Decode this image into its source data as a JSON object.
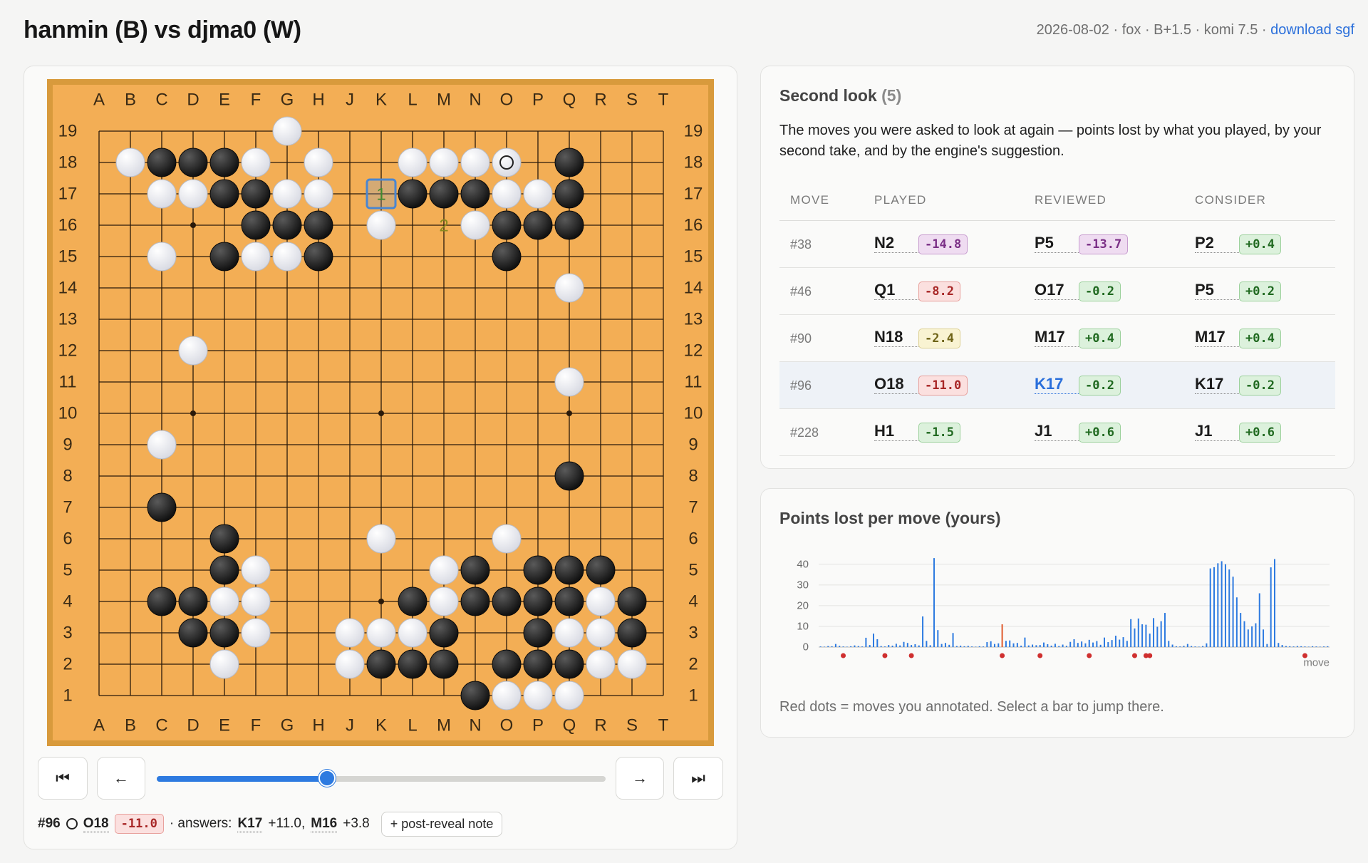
{
  "page": {
    "title": "hanmin (B) vs djma0 (W)",
    "meta": "2026-08-02 · fox · B+1.5 · komi 7.5 ·",
    "download": "download sgf"
  },
  "board": {
    "size": 19,
    "col_labels": [
      "A",
      "B",
      "C",
      "D",
      "E",
      "F",
      "G",
      "H",
      "J",
      "K",
      "L",
      "M",
      "N",
      "O",
      "P",
      "Q",
      "R",
      "S",
      "T"
    ],
    "row_labels": [
      "19",
      "18",
      "17",
      "16",
      "15",
      "14",
      "13",
      "12",
      "11",
      "10",
      "9",
      "8",
      "7",
      "6",
      "5",
      "4",
      "3",
      "2",
      "1"
    ],
    "colors": {
      "wood": "#f3ae55",
      "frame": "#d89a3c"
    },
    "black": [
      "C18",
      "D18",
      "E18",
      "E17",
      "F17",
      "F16",
      "G16",
      "H16",
      "E15",
      "H15",
      "L17",
      "M17",
      "N17",
      "O16",
      "P16",
      "Q16",
      "Q17",
      "Q18",
      "O15",
      "Q8",
      "C7",
      "E6",
      "E5",
      "N5",
      "P5",
      "Q5",
      "R5",
      "C4",
      "D4",
      "L4",
      "N4",
      "O4",
      "P4",
      "Q4",
      "S4",
      "D3",
      "E3",
      "M3",
      "P3",
      "S3",
      "K2",
      "L2",
      "M2",
      "O2",
      "P2",
      "Q2",
      "N1"
    ],
    "white": [
      "G19",
      "B18",
      "F18",
      "H18",
      "L18",
      "M18",
      "N18",
      "O18",
      "C17",
      "D17",
      "G17",
      "H17",
      "O17",
      "P17",
      "K16",
      "N16",
      "C15",
      "F15",
      "G15",
      "Q14",
      "D12",
      "Q11",
      "C9",
      "K6",
      "O6",
      "F5",
      "M5",
      "E4",
      "F4",
      "M4",
      "R4",
      "F3",
      "J3",
      "K3",
      "L3",
      "Q3",
      "R3",
      "E2",
      "J2",
      "R2",
      "S2",
      "O1",
      "P1",
      "Q1"
    ],
    "hoshi": [
      "D16",
      "K16",
      "Q16",
      "D10",
      "K10",
      "Q10",
      "D4",
      "K4",
      "Q4"
    ],
    "last_move": "O18",
    "highlight": "K17",
    "markers": [
      {
        "point": "K17",
        "label": "1",
        "color": "#3f8a2e"
      },
      {
        "point": "M16",
        "label": "2",
        "color": "#8a8a1e"
      }
    ]
  },
  "controls": {
    "first_icon": "⏮",
    "prev_icon": "←",
    "next_icon": "→",
    "last_icon": "⏭",
    "slider_value": 0.38
  },
  "move_bar": {
    "number": "#96",
    "coord": "O18",
    "loss": "-11.0",
    "answers_label": "· answers:",
    "ans1_coord": "K17",
    "ans1_val": "+11.0,",
    "ans2_coord": "M16",
    "ans2_val": "+3.8",
    "note_button": "+ post-reveal note"
  },
  "review": {
    "title": "Second look",
    "count": "(5)",
    "description": "The moves you were asked to look at again — points lost by what you played, by your second take, and by the engine's suggestion.",
    "headers": [
      "MOVE",
      "PLAYED",
      "REVIEWED",
      "CONSIDER"
    ],
    "rows": [
      {
        "move": "#38",
        "played": "N2",
        "played_loss": "-14.8",
        "reviewed": "P5",
        "reviewed_loss": "-13.7",
        "consider": "P2",
        "consider_loss": "+0.4"
      },
      {
        "move": "#46",
        "played": "Q1",
        "played_loss": "-8.2",
        "reviewed": "O17",
        "reviewed_loss": "-0.2",
        "consider": "P5",
        "consider_loss": "+0.2"
      },
      {
        "move": "#90",
        "played": "N18",
        "played_loss": "-2.4",
        "reviewed": "M17",
        "reviewed_loss": "+0.4",
        "consider": "M17",
        "consider_loss": "+0.4"
      },
      {
        "move": "#96",
        "played": "O18",
        "played_loss": "-11.0",
        "reviewed": "K17",
        "reviewed_loss": "-0.2",
        "consider": "K17",
        "consider_loss": "-0.2"
      },
      {
        "move": "#228",
        "played": "H1",
        "played_loss": "-1.5",
        "reviewed": "J1",
        "reviewed_loss": "+0.6",
        "consider": "J1",
        "consider_loss": "+0.6"
      }
    ]
  },
  "chart": {
    "title": "Points lost per move (yours)",
    "footnote": "Red dots = moves you annotated. Select a bar to jump there."
  },
  "chart_data": {
    "type": "bar",
    "title": "Points lost per move (yours)",
    "xlabel": "move",
    "ylabel": "",
    "ylim": [
      0,
      42
    ],
    "yticks": [
      0,
      10,
      20,
      30,
      40
    ],
    "n_moves": 135,
    "bar_color": "#2d7ae0",
    "highlight_color": "#e05a2d",
    "highlight_index": 48,
    "values": [
      0.3,
      0.2,
      0.5,
      0.4,
      1.5,
      0.6,
      0.3,
      0.2,
      0.4,
      0.8,
      0.5,
      0.3,
      4.5,
      1.0,
      6.5,
      3.8,
      0.5,
      0.3,
      1.0,
      0.7,
      1.6,
      0.8,
      2.5,
      2.0,
      1.0,
      1.4,
      0.8,
      14.8,
      3.0,
      0.9,
      43.0,
      8.2,
      1.5,
      2.0,
      1.1,
      6.8,
      0.5,
      0.7,
      0.4,
      0.6,
      0.3,
      0.2,
      0.4,
      0.3,
      2.4,
      2.8,
      1.5,
      1.8,
      11.0,
      3.0,
      3.2,
      1.8,
      2.0,
      0.7,
      4.6,
      0.8,
      1.2,
      0.9,
      1.0,
      2.2,
      1.4,
      0.7,
      1.6,
      0.5,
      1.2,
      0.6,
      2.5,
      3.8,
      2.0,
      2.7,
      1.8,
      3.5,
      2.2,
      2.9,
      1.1,
      4.6,
      2.4,
      3.4,
      5.5,
      3.6,
      4.8,
      3.0,
      13.5,
      9.0,
      13.8,
      11.0,
      10.8,
      6.5,
      14.0,
      9.8,
      12.5,
      16.5,
      3.0,
      1.2,
      0.4,
      0.3,
      0.6,
      1.5,
      0.5,
      0.3,
      0.2,
      0.5,
      1.8,
      38.0,
      38.6,
      40.5,
      41.5,
      40.0,
      37.5,
      34.0,
      24.0,
      16.5,
      12.5,
      8.5,
      10.0,
      11.5,
      26.0,
      8.5,
      1.5,
      38.5,
      42.5,
      2.0,
      1.0,
      0.5,
      0.4,
      0.3,
      0.5,
      0.4,
      0.3,
      0.2,
      0.4,
      0.3,
      0.2,
      0.3,
      0.4
    ],
    "annotated_moves": [
      6,
      17,
      24,
      48,
      58,
      71,
      83,
      86,
      87,
      128
    ]
  }
}
